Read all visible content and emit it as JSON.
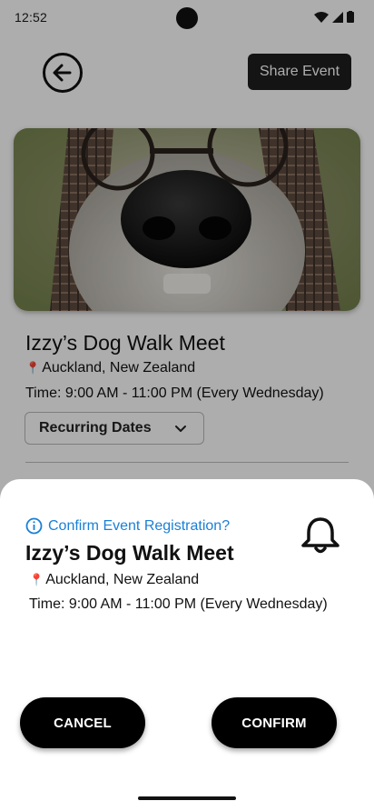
{
  "status_bar": {
    "time": "12:52",
    "icons": [
      "wifi-icon",
      "signal-icon",
      "battery-icon"
    ]
  },
  "header": {
    "back_icon": "arrow-left-circle-icon",
    "share_label": "Share Event"
  },
  "event": {
    "photo_alt": "Close-up of a dog's nose wearing glasses and a plaid hat",
    "title": "Izzy’s Dog Walk Meet",
    "location": "Auckland, New Zealand",
    "location_icon": "pin-icon",
    "time": "Time: 9:00 AM - 11:00 PM (Every Wednesday)",
    "recurring_label": "Recurring Dates"
  },
  "sheet": {
    "prompt": "Confirm Event Registration?",
    "prompt_icon": "info-icon",
    "bell_icon": "bell-icon",
    "title": "Izzy’s Dog Walk Meet",
    "location": "Auckland, New Zealand",
    "time": "Time: 9:00 AM - 11:00 PM (Every Wednesday)",
    "cancel_label": "CANCEL",
    "confirm_label": "CONFIRM"
  },
  "colors": {
    "accent": "#1a7fd6",
    "button_bg": "#000000",
    "pin": "#d9262b"
  }
}
